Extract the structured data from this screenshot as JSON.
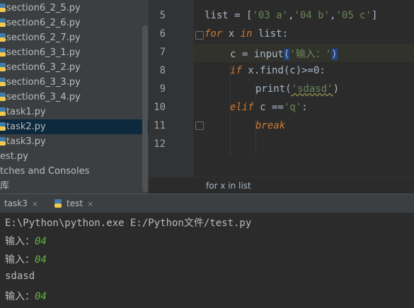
{
  "project_tree": {
    "items": [
      {
        "label": "section6_2_5.py"
      },
      {
        "label": "section6_2_6.py"
      },
      {
        "label": "section6_2_7.py"
      },
      {
        "label": "section6_3_1.py"
      },
      {
        "label": "section6_3_2.py"
      },
      {
        "label": "section6_3_3.py"
      },
      {
        "label": "section6_3_4.py"
      },
      {
        "label": "task1.py"
      },
      {
        "label": "task2.py",
        "selected": true
      },
      {
        "label": "task3.py"
      },
      {
        "label": "est.py"
      },
      {
        "label": "tches and Consoles"
      },
      {
        "label": "库"
      }
    ]
  },
  "editor": {
    "line_numbers": [
      "5",
      "6",
      "7",
      "8",
      "9",
      "10",
      "11",
      "12"
    ],
    "code": {
      "l5": {
        "a": "list = [",
        "s1": "'03 a'",
        "c1": ",",
        "s2": "'04 b'",
        "c2": ",",
        "s3": "'05 c'",
        "b": "]"
      },
      "l6": {
        "kw1": "for",
        "v": " x ",
        "kw2": "in",
        "rest": " list:"
      },
      "l7": {
        "a": "c = input",
        "p1": "(",
        "s": "'输入：'",
        "p2": ")"
      },
      "l8": {
        "kw": "if",
        "rest": " x.find(c)>=0:"
      },
      "l9": {
        "a": "print(",
        "s": "'sdasd'",
        "b": ")"
      },
      "l10": {
        "kw": "elif",
        "rest": " c ==",
        "s": "'q'",
        "b": ":"
      },
      "l11": {
        "kw": "break"
      }
    },
    "breadcrumb": "for x in list"
  },
  "run_panel": {
    "tabs": [
      {
        "label": "task3",
        "close": "×"
      },
      {
        "label": "test",
        "close": "×"
      }
    ],
    "console": {
      "command": "E:\\Python\\python.exe E:/Python文件/test.py",
      "lines": [
        {
          "prompt": "输入：",
          "input": "04"
        },
        {
          "prompt": "输入：",
          "input": "04"
        },
        {
          "text": "sdasd"
        },
        {
          "prompt": "输入：",
          "input": "04"
        }
      ]
    }
  },
  "colors": {
    "keyword": "#cc7832",
    "string": "#6a8759",
    "console_input": "#62b543"
  }
}
